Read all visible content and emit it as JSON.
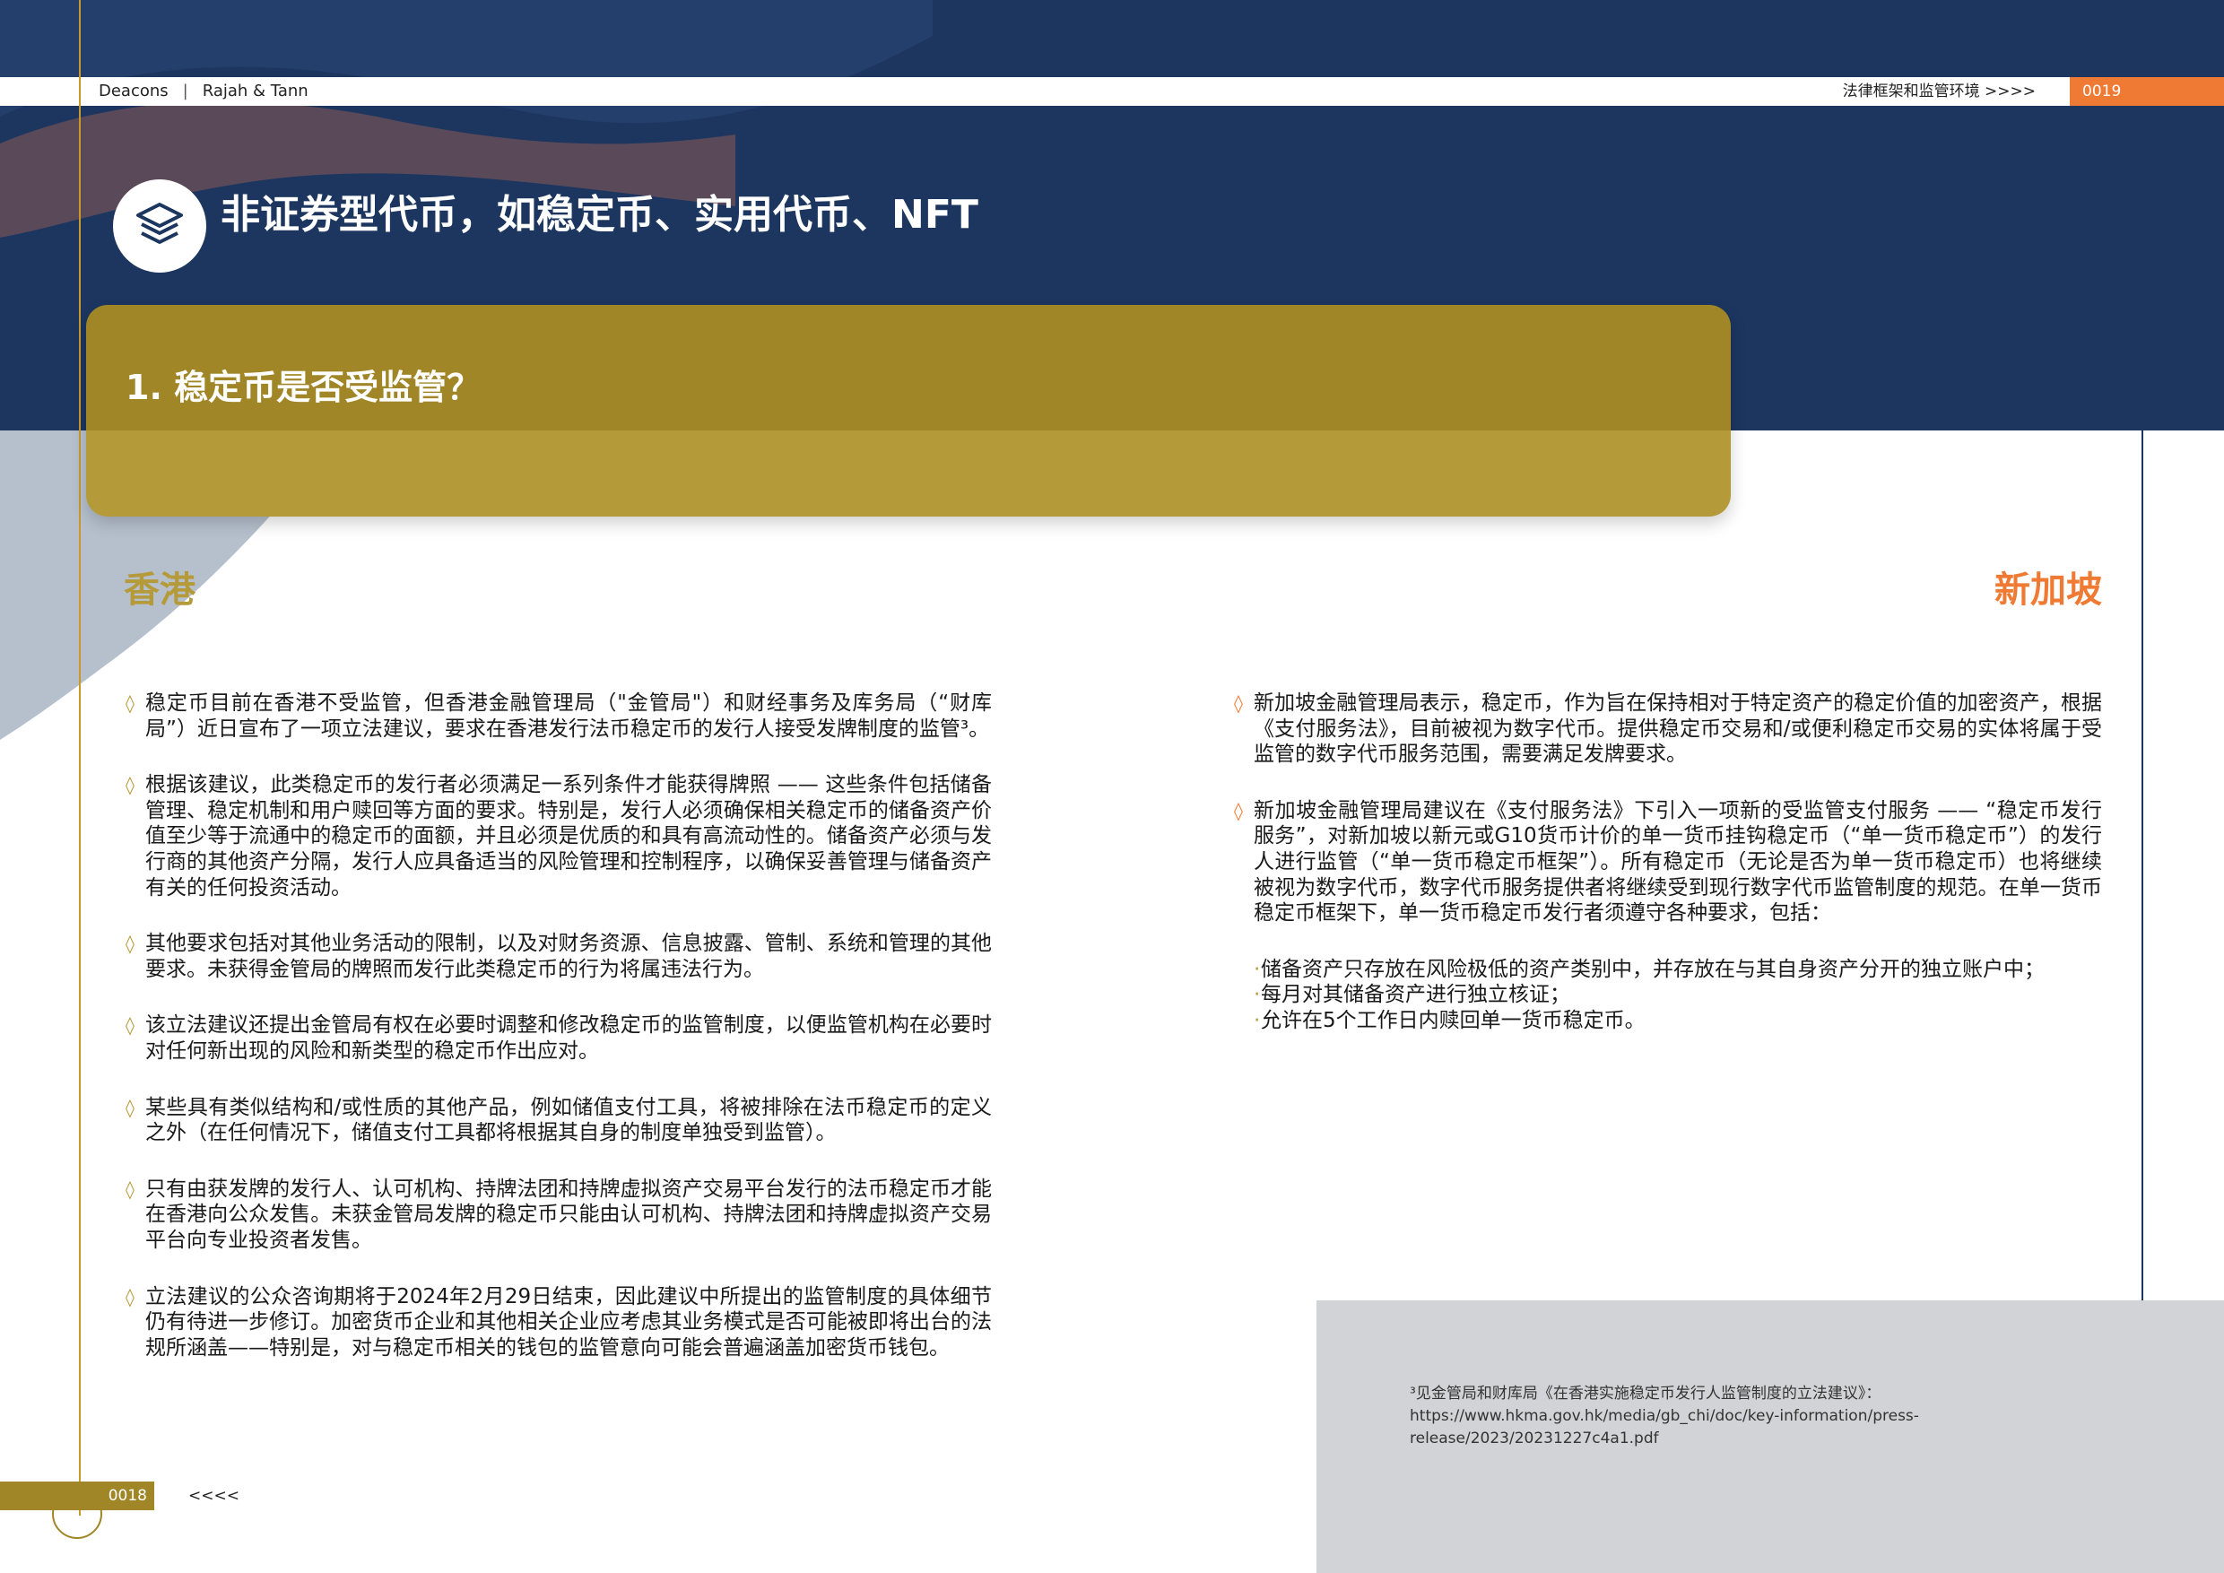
{
  "header": {
    "firm_1": "Deacons",
    "separator": "|",
    "firm_2": "Rajah & Tann",
    "section": "法律框架和监管环境  >>>>",
    "page_right": "0019"
  },
  "title": {
    "icon": "layers-icon",
    "text": "非证券型代币，如稳定币、实用代币、NFT"
  },
  "question": "1. 稳定币是否受监管？",
  "hong_kong": {
    "heading": "香港",
    "paragraphs": [
      "稳定币目前在香港不受监管，但香港金融管理局（\"金管局\"）和财经事务及库务局（“财库局”）近日宣布了一项立法建议，要求在香港发行法币稳定币的发行人接受发牌制度的监管³。",
      "根据该建议，此类稳定币的发行者必须满足一系列条件才能获得牌照 —— 这些条件包括储备管理、稳定机制和用户赎回等方面的要求。特别是，发行人必须确保相关稳定币的储备资产价值至少等于流通中的稳定币的面额，并且必须是优质的和具有高流动性的。储备资产必须与发行商的其他资产分隔，发行人应具备适当的风险管理和控制程序，以确保妥善管理与储备资产有关的任何投资活动。",
      "其他要求包括对其他业务活动的限制，以及对财务资源、信息披露、管制、系统和管理的其他要求。未获得金管局的牌照而发行此类稳定币的行为将属违法行为。",
      "该立法建议还提出金管局有权在必要时调整和修改稳定币的监管制度，以便监管机构在必要时对任何新出现的风险和新类型的稳定币作出应对。",
      "某些具有类似结构和/或性质的其他产品，例如储值支付工具，将被排除在法币稳定币的定义之外（在任何情况下，储值支付工具都将根据其自身的制度单独受到监管）。",
      "只有由获发牌的发行人、认可机构、持牌法团和持牌虚拟资产交易平台发行的法币稳定币才能在香港向公众发售。未获金管局发牌的稳定币只能由认可机构、持牌法团和持牌虚拟资产交易平台向专业投资者发售。",
      "立法建议的公众咨询期将于2024年2月29日结束，因此建议中所提出的监管制度的具体细节仍有待进一步修订。加密货币企业和其他相关企业应考虑其业务模式是否可能被即将出台的法规所涵盖——特别是，对与稳定币相关的钱包的监管意向可能会普遍涵盖加密货币钱包。"
    ]
  },
  "singapore": {
    "heading": "新加坡",
    "paragraphs": [
      "新加坡金融管理局表示，稳定币，作为旨在保持相对于特定资产的稳定价值的加密资产，根据《支付服务法》，目前被视为数字代币。提供稳定币交易和/或便利稳定币交易的实体将属于受监管的数字代币服务范围，需要满足发牌要求。",
      "新加坡金融管理局建议在《支付服务法》下引入一项新的受监管支付服务 —— “稳定币发行服务”，对新加坡以新元或G10货币计价的单一货币挂钩稳定币（“单一货币稳定币”）的发行人进行监管（“单一货币稳定币框架”）。所有稳定币（无论是否为单一货币稳定币）也将继续被视为数字代币，数字代币服务提供者将继续受到现行数字代币监管制度的规范。在单一货币稳定币框架下，单一货币稳定币发行者须遵守各种要求，包括："
    ],
    "sub_items": [
      "储备资产只存放在风险极低的资产类别中，并存放在与其自身资产分开的独立账户中；",
      "每月对其储备资产进行独立核证；",
      "允许在5个工作日内赎回单一货币稳定币。"
    ]
  },
  "footnote": "³见金管局和财库局《在香港实施稳定币发行人监管制度的立法建议》：https://www.hkma.gov.hk/media/gb_chi/doc/key-information/press-release/2023/20231227c4a1.pdf",
  "footer": {
    "page_left": "0018",
    "back": "<<<<"
  },
  "colors": {
    "navy": "#1c3660",
    "gold": "#a08626",
    "gold_light": "#b59a3a",
    "orange": "#ef7a33",
    "footnote_bg": "#d1d3d6"
  }
}
